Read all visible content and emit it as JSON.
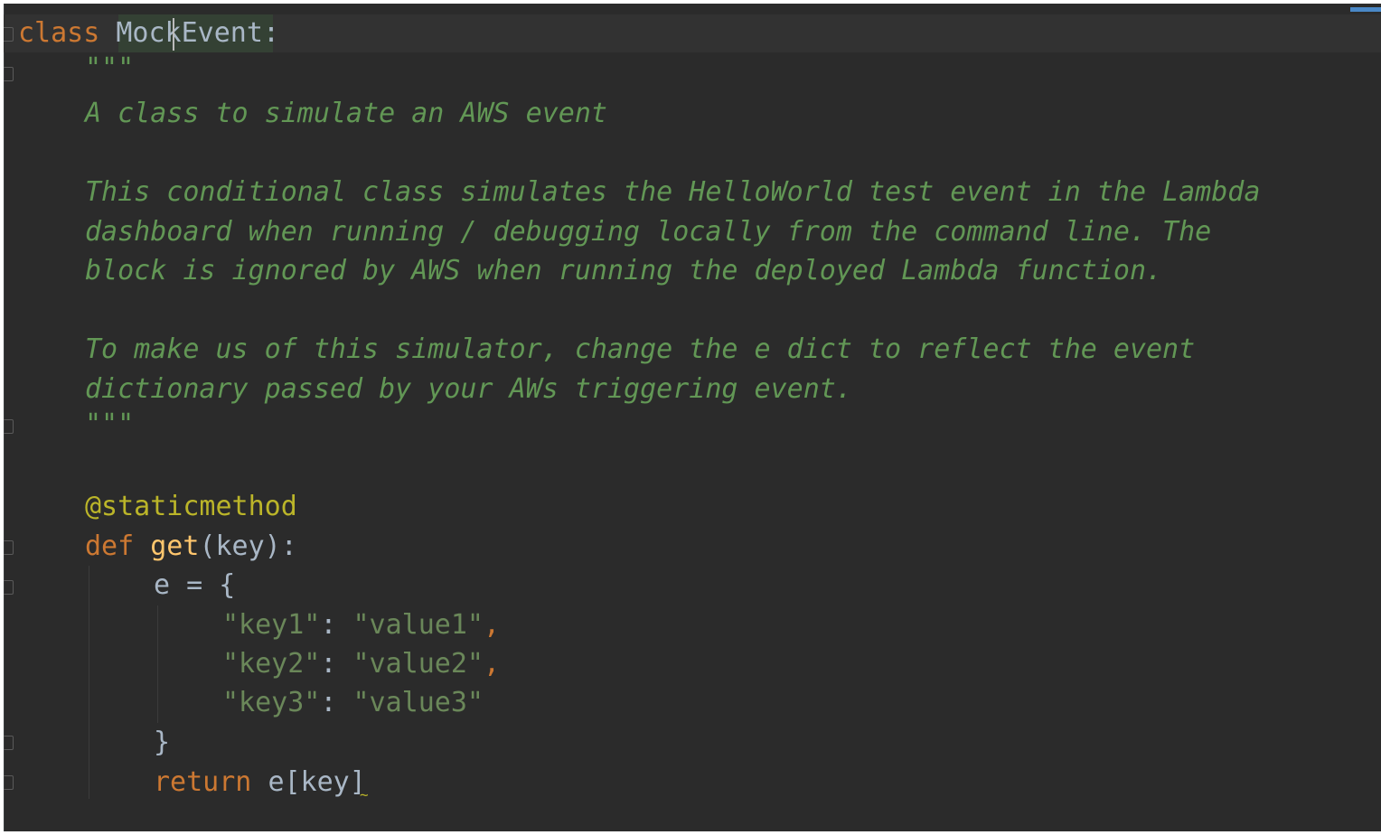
{
  "code": {
    "class_keyword": "class",
    "class_name": "MockEvent",
    "class_colon": ":",
    "docstring_open": "\"\"\"",
    "doc_line1": "A class to simulate an AWS event",
    "doc_line2": "This conditional class simulates the HelloWorld test event in the Lambda",
    "doc_line3": "dashboard when running / debugging locally from the command line. The",
    "doc_line4": "block is ignored by AWS when running the deployed Lambda function.",
    "doc_line5": "To make us of this simulator, change the e dict to reflect the event",
    "doc_line6": "dictionary passed by your AWs triggering event.",
    "docstring_close": "\"\"\"",
    "decorator": "@staticmethod",
    "def_keyword": "def",
    "func_name": "get",
    "func_params": "(key):",
    "assign": "e = {",
    "dict_entries": [
      {
        "key": "\"key1\"",
        "sep": ": ",
        "value": "\"value1\"",
        "comma": ","
      },
      {
        "key": "\"key2\"",
        "sep": ": ",
        "value": "\"value2\"",
        "comma": ","
      },
      {
        "key": "\"key3\"",
        "sep": ": ",
        "value": "\"value3\"",
        "comma": ""
      }
    ],
    "close_brace": "}",
    "return_keyword": "return",
    "return_expr": "e[key]"
  },
  "colors": {
    "background": "#2b2b2b",
    "keyword": "#cc7832",
    "docstring": "#629755",
    "decorator": "#bbb529",
    "function": "#ffc66d",
    "string": "#6a8759",
    "default": "#a9b7c6"
  }
}
